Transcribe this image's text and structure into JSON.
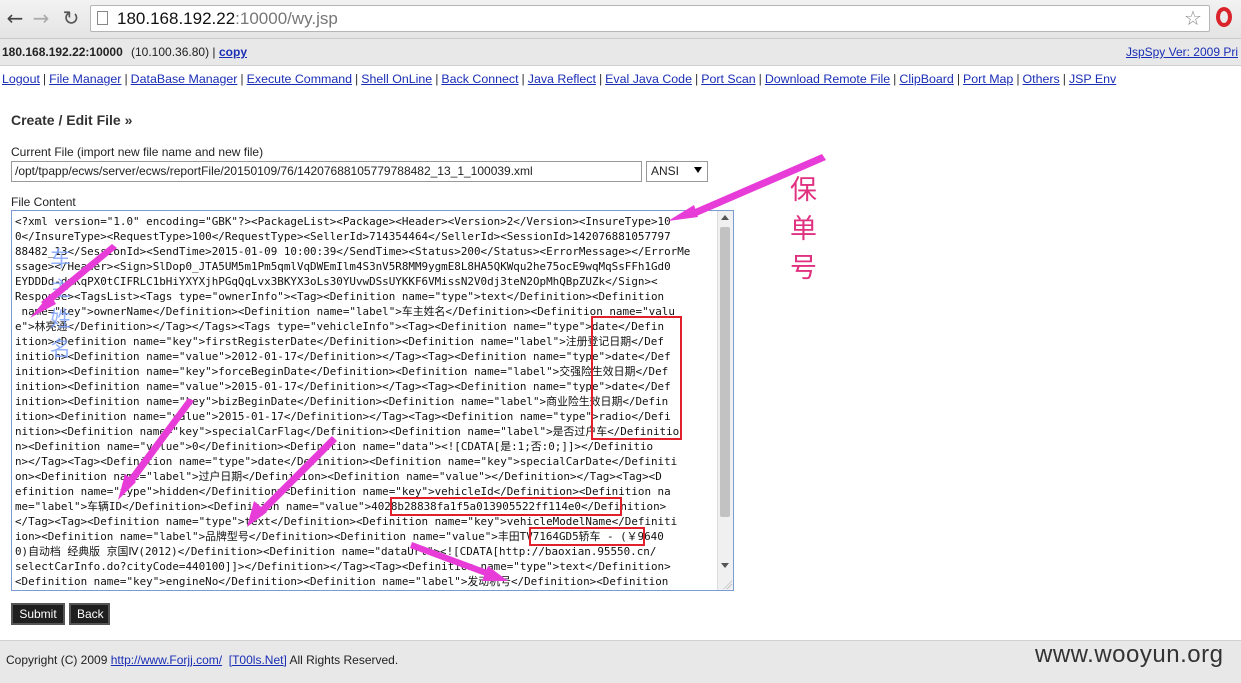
{
  "browser": {
    "url_host": "180.168.192.22",
    "url_rest": ":10000/wy.jsp"
  },
  "infobar": {
    "host": "180.168.192.22:10000",
    "ip": "(10.100.36.80) |",
    "copy": "copy",
    "version": "JspSpy Ver: 2009 Pri"
  },
  "menu": {
    "items": [
      {
        "label": "Logout"
      },
      {
        "label": "File Manager"
      },
      {
        "label": "DataBase Manager"
      },
      {
        "label": "Execute Command"
      },
      {
        "label": "Shell OnLine"
      },
      {
        "label": "Back Connect"
      },
      {
        "label": "Java Reflect"
      },
      {
        "label": "Eval Java Code"
      },
      {
        "label": "Port Scan"
      },
      {
        "label": "Download Remote File"
      },
      {
        "label": "ClipBoard"
      },
      {
        "label": "Port Map"
      },
      {
        "label": "Others"
      },
      {
        "label": "JSP Env"
      }
    ]
  },
  "form": {
    "heading": "Create / Edit File »",
    "current_file_label": "Current File (import new file name and new file)",
    "current_file_value": "/opt/tpapp/ecws/server/ecws/reportFile/20150109/76/14207688105779788482_13_1_100039.xml",
    "encoding": "ANSI",
    "content_label": "File Content",
    "submit": "Submit",
    "back": "Back"
  },
  "editor": {
    "lines": [
      "<?xml version=\"1.0\" encoding=\"GBK\"?><PackageList><Package><Header><Version>2</Version><InsureType>10",
      "0</InsureType><RequestType>100</RequestType><SellerId>714354464</SellerId><SessionId>142076881057797",
      "88482_13</SessionId><SendTime>2015-01-09 10:00:39</SendTime><Status>200</Status><ErrorMessage></ErrorMe",
      "ssage></Header><Sign>SlDop0_JTA5UM5m1Pm5qmlVqDWEmIlm4S3nV5R8MM9ygmE8L8HA5QKWqu2he75ocE9wqMqSsFFh1Gd0",
      "EYDDDd-dmKqPX0tCIFRLC1bHiYXYXjhPGqQqLvx3BKYX3oLs30YUvwDSsUYKKF6VMissN2V0dj3teN2OpMhQBpZUZk</Sign><",
      "Response><TagsList><Tags type=\"ownerInfo\"><Tag><Definition name=\"type\">text</Definition><Definition",
      " name=\"key\">ownerName</Definition><Definition name=\"label\">车主姓名</Definition><Definition name=\"valu",
      "e\">林亮通</Definition></Tag></Tags><Tags type=\"vehicleInfo\"><Tag><Definition name=\"type\">date</Defin",
      "ition><Definition name=\"key\">firstRegisterDate</Definition><Definition name=\"label\">注册登记日期</Def",
      "inition><Definition name=\"value\">2012-01-17</Definition></Tag><Tag><Definition name=\"type\">date</Def",
      "inition><Definition name=\"key\">forceBeginDate</Definition><Definition name=\"label\">交强险生效日期</Def",
      "inition><Definition name=\"value\">2015-01-17</Definition></Tag><Tag><Definition name=\"type\">date</Def",
      "inition><Definition name=\"key\">bizBeginDate</Definition><Definition name=\"label\">商业险生效日期</Defin",
      "ition><Definition name=\"value\">2015-01-17</Definition></Tag><Tag><Definition name=\"type\">radio</Defi",
      "nition><Definition name=\"key\">specialCarFlag</Definition><Definition name=\"label\">是否过户车</Definitio",
      "n><Definition name=\"value\">0</Definition><Definition name=\"data\"><![CDATA[是:1;否:0;]]></Definitio",
      "n></Tag><Tag><Definition name=\"type\">date</Definition><Definition name=\"key\">specialCarDate</Definiti",
      "on><Definition name=\"label\">过户日期</Definition><Definition name=\"value\"></Definition></Tag><Tag><D",
      "efinition name=\"type\">hidden</Definition><Definition name=\"key\">vehicleId</Definition><Definition na",
      "me=\"label\">车辆ID</Definition><Definition name=\"value\">4028b28838fa1f5a013905522ff114e0</Definition>",
      "</Tag><Tag><Definition name=\"type\">text</Definition><Definition name=\"key\">vehicleModelName</Definiti",
      "ion><Definition name=\"label\">品牌型号</Definition><Definition name=\"value\">丰田TV7164GD5轿车 - (￥9640",
      "0)自动档 经典版 京国Ⅳ(2012)</Definition><Definition name=\"dataUrl\"><![CDATA[http://baoxian.95550.cn/",
      "selectCarInfo.do?cityCode=440100]]></Definition></Tag><Tag><Definition name=\"type\">text</Definition>",
      "<Definition name=\"key\">engineNo</Definition><Definition name=\"label\">发动机号</Definition><Definition"
    ]
  },
  "footer": {
    "copyright_prefix": "Copyright (C) 2009",
    "link1": "http://www.Forjj.com/",
    "link2": "[T00ls.Net]",
    "suffix": "All Rights Reserved.",
    "watermark": "www.wooyun.org"
  },
  "annotations": {
    "policy_label": "保单号",
    "owner_label": "车主姓名",
    "color": "#e83cd8"
  }
}
